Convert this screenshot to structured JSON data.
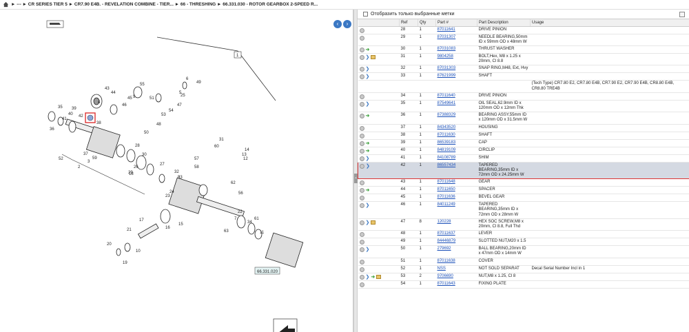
{
  "breadcrumb": {
    "items": [
      "---",
      "CR SERIES TIER 5",
      "CR7.90 E4B. - REVELATION COMBINE - TIER...",
      "66 - THRESHING",
      "66.331.030 - ROTOR GEARBOX 2-SPEED R..."
    ]
  },
  "filter": {
    "label": "Отобразить только выбранные метки"
  },
  "table": {
    "headers": [
      "",
      "Ref",
      "Qty",
      "Part #",
      "Part Description",
      "Usage"
    ],
    "rows": [
      {
        "icons": [
          "circle"
        ],
        "ref": "28",
        "qty": "1",
        "part": "87011641",
        "desc": "DRIVE PINION",
        "usage": ""
      },
      {
        "icons": [
          "circle"
        ],
        "ref": "29",
        "qty": "1",
        "part": "87031307",
        "desc": "NEEDLE BEARING,50mm ID x 59mm OD x 48mm W",
        "usage": ""
      },
      {
        "icons": [
          "circle",
          "arrow"
        ],
        "ref": "30",
        "qty": "1",
        "part": "87031083",
        "desc": "THRUST WASHER",
        "usage": ""
      },
      {
        "icons": [
          "circle",
          "book",
          "box"
        ],
        "ref": "31",
        "qty": "1",
        "part": "9804258",
        "desc": "BOLT,Hex, M8 x 1.25 x 20mm, Cl 8.8",
        "usage": ""
      },
      {
        "icons": [
          "circle",
          "book"
        ],
        "ref": "32",
        "qty": "1",
        "part": "87031303",
        "desc": "SNAP RING,M48, Ext, Hvy",
        "usage": ""
      },
      {
        "icons": [
          "circle",
          "book"
        ],
        "ref": "33",
        "qty": "1",
        "part": "87621999",
        "desc": "SHAFT",
        "usage": ""
      },
      {
        "icons": [],
        "ref": "",
        "qty": "",
        "part": "",
        "desc": "",
        "usage": "(Tech Type) CR7.80 E2, CR7.80 E4B, CR7.90 E2, CR7.90 E4B, CR8.80 E4B, CR8.80 TRE4B"
      },
      {
        "icons": [
          "circle"
        ],
        "ref": "34",
        "qty": "1",
        "part": "87011640",
        "desc": "DRIVE PINION",
        "usage": ""
      },
      {
        "icons": [
          "circle",
          "book"
        ],
        "ref": "35",
        "qty": "1",
        "part": "87549641",
        "desc": "OIL SEAL,62.9mm ID x 120mm OD x 12mm Thk",
        "usage": ""
      },
      {
        "icons": [
          "circle",
          "arrow"
        ],
        "ref": "36",
        "qty": "1",
        "part": "87388329",
        "desc": "BEARING ASSY,55mm ID x 120mm OD x 31.5mm W",
        "usage": ""
      },
      {
        "icons": [
          "circle"
        ],
        "ref": "37",
        "qty": "1",
        "part": "84343520",
        "desc": "HOUSING",
        "usage": ""
      },
      {
        "icons": [
          "circle"
        ],
        "ref": "38",
        "qty": "1",
        "part": "87011630",
        "desc": "SHAFT",
        "usage": ""
      },
      {
        "icons": [
          "circle",
          "arrow"
        ],
        "ref": "39",
        "qty": "1",
        "part": "86539183",
        "desc": "CAP",
        "usage": ""
      },
      {
        "icons": [
          "circle",
          "arrow"
        ],
        "ref": "40",
        "qty": "1",
        "part": "84819109",
        "desc": "CIRCLIP",
        "usage": ""
      },
      {
        "icons": [
          "circle",
          "book"
        ],
        "ref": "41",
        "qty": "1",
        "part": "84108789",
        "desc": "SHIM",
        "usage": ""
      },
      {
        "icons": [
          "circle",
          "book"
        ],
        "ref": "42",
        "qty": "1",
        "part": "86557434",
        "desc": "TAPERED BEARING,35mm ID x 72mm OD x 24.25mm W",
        "usage": "",
        "selected": true
      },
      {
        "icons": [
          "circle"
        ],
        "ref": "43",
        "qty": "1",
        "part": "87011648",
        "desc": "GEAR",
        "usage": ""
      },
      {
        "icons": [
          "circle",
          "arrow"
        ],
        "ref": "44",
        "qty": "1",
        "part": "87011650",
        "desc": "SPACER",
        "usage": ""
      },
      {
        "icons": [
          "circle"
        ],
        "ref": "45",
        "qty": "1",
        "part": "87011636",
        "desc": "BEVEL GEAR",
        "usage": ""
      },
      {
        "icons": [
          "circle",
          "book"
        ],
        "ref": "46",
        "qty": "1",
        "part": "84011249",
        "desc": "TAPERED BEARING,35mm ID x 72mm OD x 28mm W",
        "usage": ""
      },
      {
        "icons": [
          "circle",
          "book",
          "box"
        ],
        "ref": "47",
        "qty": "8",
        "part": "120228",
        "desc": "HEX SOC SCREW,M8 x 20mm, Cl 8.8, Full Thd",
        "usage": ""
      },
      {
        "icons": [
          "circle"
        ],
        "ref": "48",
        "qty": "1",
        "part": "87011637",
        "desc": "LEVER",
        "usage": ""
      },
      {
        "icons": [
          "circle"
        ],
        "ref": "49",
        "qty": "1",
        "part": "84446879",
        "desc": "SLOTTED NUT,M20 x 1.5",
        "usage": ""
      },
      {
        "icons": [
          "circle",
          "book"
        ],
        "ref": "50",
        "qty": "1",
        "part": "279692",
        "desc": "BALL BEARING,20mm ID x 47mm OD x 14mm W",
        "usage": ""
      },
      {
        "icons": [
          "circle"
        ],
        "ref": "51",
        "qty": "1",
        "part": "87011638",
        "desc": "COVER",
        "usage": ""
      },
      {
        "icons": [
          "circle"
        ],
        "ref": "52",
        "qty": "1",
        "part": "NSS",
        "desc": "NOT SOLD SEPARAT",
        "usage": "Decal Serial Number Incl in 1"
      },
      {
        "icons": [
          "circle",
          "book",
          "arrow",
          "box"
        ],
        "ref": "53",
        "qty": "2",
        "part": "9706690",
        "desc": "NUT,M8 x 1.25, Cl 8",
        "usage": ""
      },
      {
        "icons": [
          "circle"
        ],
        "ref": "54",
        "qty": "1",
        "part": "87011643",
        "desc": "FIXING PLATE",
        "usage": ""
      }
    ]
  },
  "diagram": {
    "callouts": [
      "1",
      "2",
      "3",
      "4",
      "5",
      "6",
      "7",
      "8",
      "9",
      "10",
      "11",
      "12",
      "13",
      "14",
      "15",
      "16",
      "17",
      "18",
      "19",
      "20",
      "21",
      "22",
      "23",
      "24",
      "25",
      "26",
      "27",
      "28",
      "29",
      "30",
      "31",
      "32",
      "33",
      "34",
      "35",
      "36",
      "37",
      "38",
      "39",
      "40",
      "41",
      "42",
      "43",
      "44",
      "45",
      "46",
      "47",
      "48",
      "49",
      "50",
      "51",
      "52",
      "53",
      "54",
      "55",
      "56",
      "57",
      "58",
      "59",
      "60",
      "61",
      "62",
      "63"
    ],
    "ref_label": "66.331.020",
    "highlight_ref": "42"
  }
}
